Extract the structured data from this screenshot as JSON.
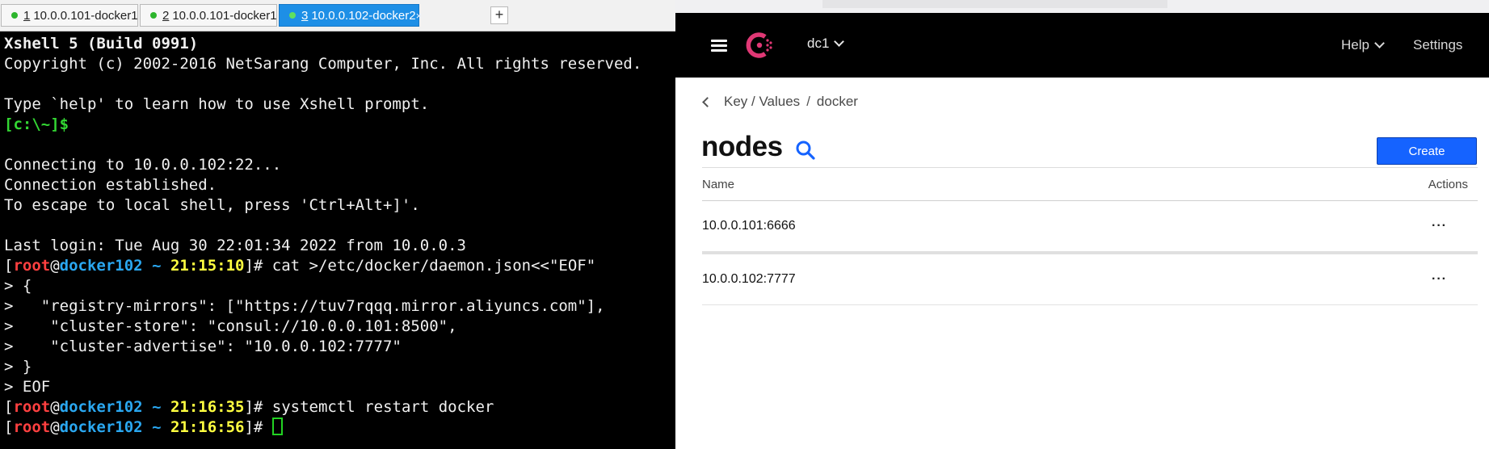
{
  "xshell": {
    "tabs": [
      {
        "num": "1",
        "label": "10.0.0.101-docker1",
        "active": false
      },
      {
        "num": "2",
        "label": "10.0.0.101-docker1",
        "active": false
      },
      {
        "num": "3",
        "label": "10.0.0.102-docker2",
        "active": true
      }
    ],
    "tab_close": "×",
    "tab_add": "+",
    "terminal": {
      "line1": "Xshell 5 (Build 0991)",
      "line2": "Copyright (c) 2002-2016 NetSarang Computer, Inc. All rights reserved.",
      "line3": "Type `help' to learn how to use Xshell prompt.",
      "local_prompt": "[c:\\~]$",
      "line5": "Connecting to 10.0.0.102:22...",
      "line6": "Connection established.",
      "line7": "To escape to local shell, press 'Ctrl+Alt+]'.",
      "line8": "Last login: Tue Aug 30 22:01:34 2022 from 10.0.0.3",
      "prompt_open": "[",
      "prompt_user": "root",
      "prompt_at": "@",
      "prompt_host": "docker102",
      "prompt_tilde": " ~ ",
      "prompt_close": "]# ",
      "time1": "21:15:10",
      "cmd1": "cat >/etc/docker/daemon.json<<\"EOF\"",
      "here1": "> {",
      "here2": ">   \"registry-mirrors\": [\"https://tuv7rqqq.mirror.aliyuncs.com\"],",
      "here3": ">    \"cluster-store\": \"consul://10.0.0.101:8500\",",
      "here4": ">    \"cluster-advertise\": \"10.0.0.102:7777\"",
      "here5": "> }",
      "here6": "> EOF",
      "time2": "21:16:35",
      "cmd2": "systemctl restart docker",
      "time3": "21:16:56"
    }
  },
  "consul": {
    "header": {
      "datacenter": "dc1",
      "help": "Help",
      "settings": "Settings"
    },
    "breadcrumb": {
      "kv": "Key / Values",
      "sep": "/",
      "folder": "docker"
    },
    "title": "nodes",
    "create_button": "Create",
    "table": {
      "col_name": "Name",
      "col_actions": "Actions",
      "rows": [
        {
          "name": "10.0.0.101:6666",
          "menu": "···"
        },
        {
          "name": "10.0.0.102:7777",
          "menu": "···"
        }
      ]
    },
    "colors": {
      "accent": "#1563ff",
      "logo": "#e03875",
      "header_bg": "#000000"
    }
  }
}
